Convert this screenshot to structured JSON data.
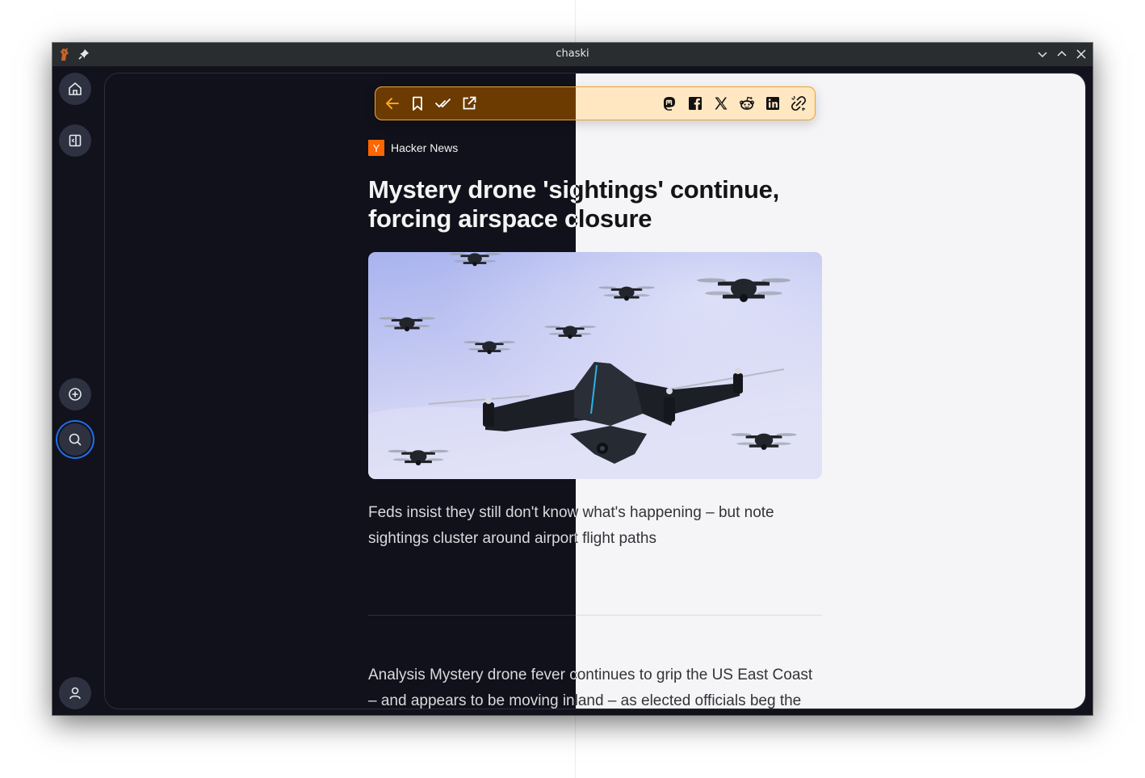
{
  "window": {
    "title": "chaski"
  },
  "sidebar": {
    "items": [
      {
        "name": "home",
        "icon": "home-icon"
      },
      {
        "name": "panel-toggle",
        "icon": "sidebar-panel-icon"
      },
      {
        "name": "add-feed",
        "icon": "plus-circle-icon"
      },
      {
        "name": "search",
        "icon": "search-icon",
        "active": true
      },
      {
        "name": "account",
        "icon": "user-icon"
      }
    ]
  },
  "toolbar": {
    "left_icons": [
      "back-arrow-icon",
      "bookmark-icon",
      "mark-read-icon",
      "open-external-icon"
    ],
    "share_icons": [
      "mastodon-icon",
      "facebook-icon",
      "x-icon",
      "reddit-icon",
      "linkedin-icon",
      "copy-link-icon"
    ],
    "accent": "#f0a030"
  },
  "article": {
    "source_initial": "Y",
    "source_name": "Hacker News",
    "title": "Mystery drone 'sightings' continue, forcing airspace closure",
    "image_alt": "drones-swarm-image",
    "lead": "Feds insist they still don't know what's happening – but note sightings cluster around airport flight paths",
    "body": "Analysis Mystery drone fever continues to grip the US East Coast – and appears to be moving inland – as elected officials beg the"
  },
  "colors": {
    "dark_bg": "#11121c",
    "light_bg": "#f5f5f8",
    "hn_orange": "#ff6600",
    "active_ring": "#1f6feb"
  }
}
